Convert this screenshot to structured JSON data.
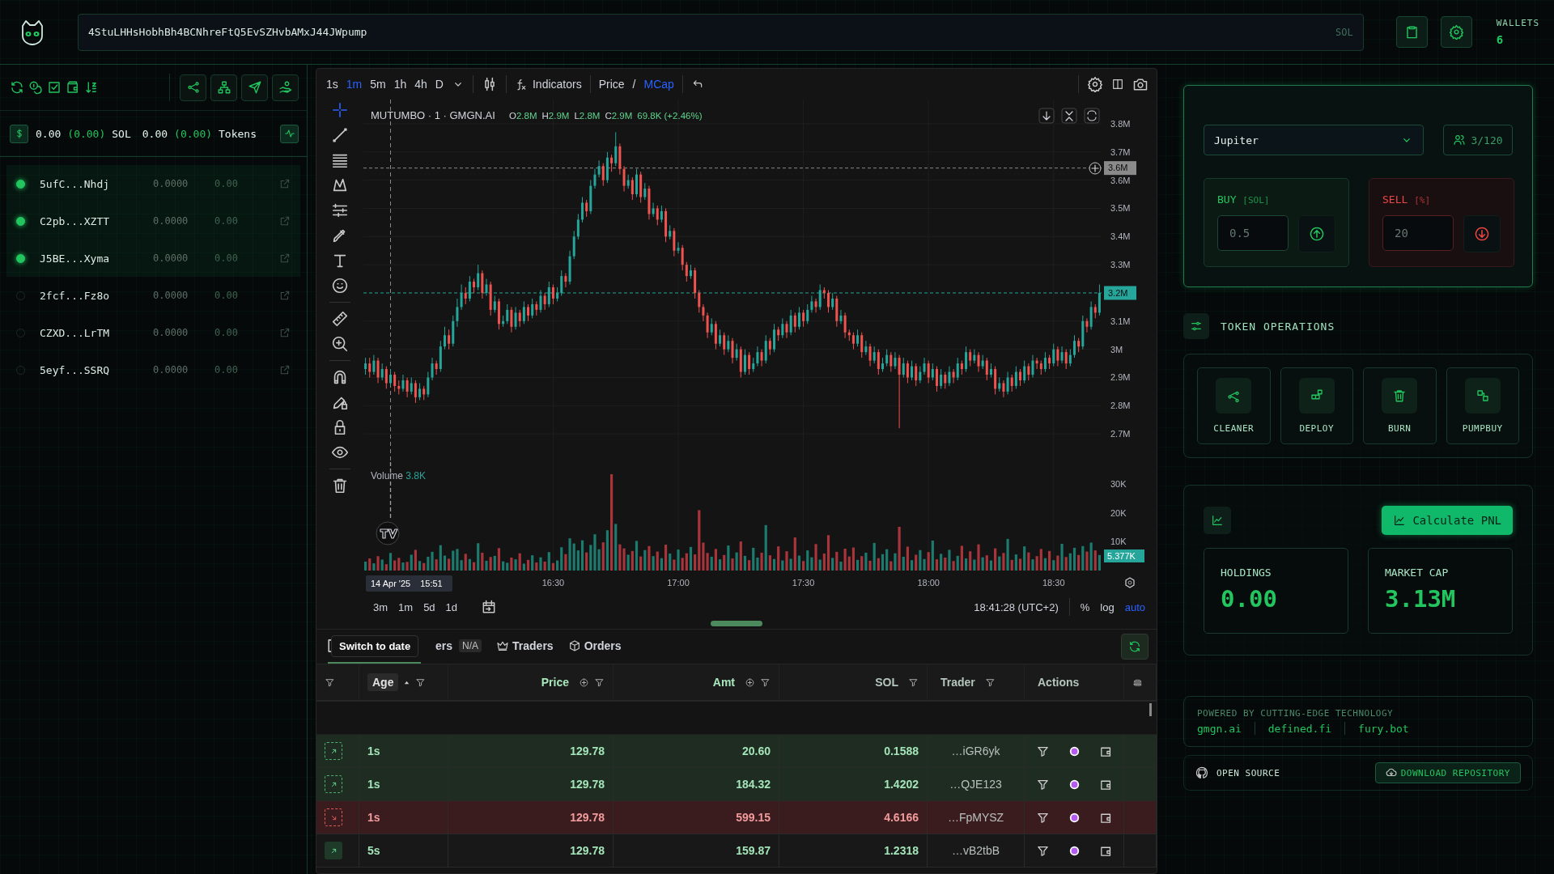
{
  "header": {
    "address": "4StuLHHsHobhBh4BCNhreFtQ5EvSZHvbAMxJ44JWpump",
    "address_suffix": "SOL",
    "wallets_label": "WALLETS",
    "wallets_count": "6"
  },
  "left_panel": {
    "balance": {
      "sol": "0.00",
      "sol_change": "(0.00)",
      "sol_unit": "SOL",
      "tokens": "0.00",
      "tokens_change": "(0.00)",
      "tokens_unit": "Tokens"
    },
    "wallets": [
      {
        "address": "5ufC...Nhdj",
        "selected": true,
        "balance": "0.0000",
        "value": "0.00"
      },
      {
        "address": "C2pb...XZTT",
        "selected": true,
        "balance": "0.0000",
        "value": "0.00"
      },
      {
        "address": "J5BE...Xyma",
        "selected": true,
        "balance": "0.0000",
        "value": "0.00"
      },
      {
        "address": "2fcf...Fz8o",
        "selected": false,
        "balance": "0.0000",
        "value": "0.00"
      },
      {
        "address": "CZXD...LrTM",
        "selected": false,
        "balance": "0.0000",
        "value": "0.00"
      },
      {
        "address": "5eyf...SSRQ",
        "selected": false,
        "balance": "0.0000",
        "value": "0.00"
      }
    ]
  },
  "chart": {
    "intervals": [
      {
        "label": "1s",
        "selected": false
      },
      {
        "label": "1m",
        "selected": true
      },
      {
        "label": "5m",
        "selected": false
      },
      {
        "label": "1h",
        "selected": false
      },
      {
        "label": "4h",
        "selected": false
      },
      {
        "label": "D",
        "selected": false
      }
    ],
    "indicators_label": "Indicators",
    "mode_separator": "/",
    "modes": [
      {
        "label": "Price",
        "selected": false
      },
      {
        "label": "MCap",
        "selected": true
      }
    ],
    "legend": {
      "title": "MUTUMBO · 1 · GMGN.AI",
      "ohlc": [
        {
          "key": "O",
          "value": "2.8M"
        },
        {
          "key": "H",
          "value": "2.9M"
        },
        {
          "key": "L",
          "value": "2.8M"
        },
        {
          "key": "C",
          "value": "2.9M"
        }
      ],
      "change": "69.8K (+2.46%)"
    },
    "price_pane": {
      "chart_data": {
        "type": "candlestick",
        "grid": true,
        "ylim": [
          2.6,
          3.886
        ],
        "ref_lines": [
          {
            "axis": "y",
            "value": 3.643,
            "label": "3.6M",
            "color": "#8a8a8a"
          },
          {
            "axis": "y",
            "value": 3.2,
            "label": "3.2M",
            "color": "#26a69a"
          }
        ],
        "yticks": [
          {
            "value": 3.8,
            "label": "3.8M"
          },
          {
            "value": 3.7,
            "label": "3.7M"
          },
          {
            "value": 3.6,
            "label": "3.6M"
          },
          {
            "value": 3.5,
            "label": "3.5M"
          },
          {
            "value": 3.4,
            "label": "3.4M"
          },
          {
            "value": 3.3,
            "label": "3.3M"
          },
          {
            "value": 3.1,
            "label": "3.1M"
          },
          {
            "value": 3.0,
            "label": "3M"
          },
          {
            "value": 2.9,
            "label": "2.9M"
          },
          {
            "value": 2.8,
            "label": "2.8M"
          },
          {
            "value": 2.7,
            "label": "2.7M"
          }
        ],
        "categories": [
          null,
          null,
          null,
          null,
          null,
          null,
          null,
          null,
          null,
          null,
          null,
          null,
          null,
          null,
          null,
          null,
          null,
          null,
          null,
          null,
          null,
          null,
          null,
          null,
          null,
          null,
          null,
          null,
          null,
          null,
          null,
          null,
          null,
          null,
          null,
          null,
          null,
          null,
          null,
          null,
          null,
          null,
          null,
          null,
          null,
          null,
          null,
          null,
          null,
          null,
          null,
          null,
          null,
          null,
          null,
          null,
          null,
          null,
          null,
          null,
          null,
          null,
          null,
          null,
          null,
          null,
          null,
          null,
          null,
          null,
          null,
          null,
          null,
          null,
          null,
          null,
          null,
          null,
          null,
          null,
          null,
          null,
          null,
          null,
          null,
          null,
          null,
          null,
          null,
          null,
          null,
          null,
          null,
          null,
          null,
          null,
          null,
          null,
          null,
          null,
          null,
          null,
          null,
          null,
          null,
          null,
          null,
          null,
          null,
          null,
          null,
          null,
          null,
          null,
          null,
          null,
          null,
          null,
          null,
          null,
          null,
          null,
          null,
          null,
          null,
          null,
          null,
          null,
          null,
          null,
          null,
          null,
          null,
          null,
          null,
          null,
          null,
          null,
          null,
          null,
          null,
          null,
          null,
          null,
          null,
          null,
          null,
          null,
          null,
          null,
          null,
          null,
          null,
          null,
          null,
          null,
          null,
          null,
          null,
          null,
          null,
          null,
          null,
          null,
          null,
          null,
          null,
          null,
          null,
          null,
          null,
          null,
          null,
          null,
          null,
          null,
          null
        ],
        "ohlc": [
          [
            2.93,
            2.97,
            2.91,
            2.95
          ],
          [
            2.95,
            2.97,
            2.9,
            2.92
          ],
          [
            2.92,
            2.98,
            2.91,
            2.96
          ],
          [
            2.96,
            2.97,
            2.88,
            2.9
          ],
          [
            2.9,
            2.95,
            2.89,
            2.93
          ],
          [
            2.93,
            2.94,
            2.86,
            2.88
          ],
          [
            2.88,
            2.93,
            2.87,
            2.91
          ],
          [
            2.91,
            2.92,
            2.85,
            2.87
          ],
          [
            2.87,
            2.89,
            2.84,
            2.86
          ],
          [
            2.86,
            2.91,
            2.85,
            2.89
          ],
          [
            2.89,
            2.9,
            2.83,
            2.85
          ],
          [
            2.85,
            2.9,
            2.84,
            2.88
          ],
          [
            2.88,
            2.89,
            2.81,
            2.83
          ],
          [
            2.83,
            2.88,
            2.82,
            2.86
          ],
          [
            2.86,
            2.87,
            2.82,
            2.84
          ],
          [
            2.84,
            2.92,
            2.83,
            2.9
          ],
          [
            2.9,
            2.97,
            2.89,
            2.95
          ],
          [
            2.95,
            2.96,
            2.91,
            2.93
          ],
          [
            2.93,
            3.03,
            2.92,
            3.01
          ],
          [
            3.01,
            3.08,
            3.0,
            3.05
          ],
          [
            3.05,
            3.07,
            3.0,
            3.02
          ],
          [
            3.02,
            3.12,
            3.01,
            3.1
          ],
          [
            3.1,
            3.18,
            3.08,
            3.15
          ],
          [
            3.15,
            3.23,
            3.14,
            3.2
          ],
          [
            3.2,
            3.22,
            3.16,
            3.18
          ],
          [
            3.18,
            3.26,
            3.17,
            3.24
          ],
          [
            3.24,
            3.25,
            3.2,
            3.22
          ],
          [
            3.22,
            3.3,
            3.21,
            3.27
          ],
          [
            3.27,
            3.28,
            3.18,
            3.2
          ],
          [
            3.2,
            3.25,
            3.19,
            3.23
          ],
          [
            3.23,
            3.24,
            3.12,
            3.14
          ],
          [
            3.14,
            3.19,
            3.13,
            3.17
          ],
          [
            3.17,
            3.18,
            3.07,
            3.09
          ],
          [
            3.09,
            3.12,
            3.08,
            3.1
          ],
          [
            3.1,
            3.16,
            3.09,
            3.14
          ],
          [
            3.14,
            3.15,
            3.06,
            3.08
          ],
          [
            3.08,
            3.15,
            3.07,
            3.13
          ],
          [
            3.13,
            3.14,
            3.08,
            3.1
          ],
          [
            3.1,
            3.17,
            3.09,
            3.15
          ],
          [
            3.15,
            3.16,
            3.1,
            3.12
          ],
          [
            3.12,
            3.18,
            3.11,
            3.16
          ],
          [
            3.16,
            3.17,
            3.12,
            3.14
          ],
          [
            3.14,
            3.21,
            3.13,
            3.19
          ],
          [
            3.19,
            3.2,
            3.14,
            3.16
          ],
          [
            3.16,
            3.24,
            3.15,
            3.22
          ],
          [
            3.22,
            3.23,
            3.16,
            3.18
          ],
          [
            3.18,
            3.22,
            3.17,
            3.2
          ],
          [
            3.2,
            3.28,
            3.19,
            3.26
          ],
          [
            3.26,
            3.27,
            3.22,
            3.24
          ],
          [
            3.24,
            3.35,
            3.23,
            3.33
          ],
          [
            3.33,
            3.42,
            3.32,
            3.4
          ],
          [
            3.4,
            3.48,
            3.39,
            3.46
          ],
          [
            3.46,
            3.54,
            3.45,
            3.52
          ],
          [
            3.52,
            3.53,
            3.47,
            3.49
          ],
          [
            3.49,
            3.6,
            3.48,
            3.58
          ],
          [
            3.58,
            3.64,
            3.57,
            3.62
          ],
          [
            3.62,
            3.67,
            3.61,
            3.65
          ],
          [
            3.65,
            3.66,
            3.58,
            3.6
          ],
          [
            3.6,
            3.7,
            3.59,
            3.68
          ],
          [
            3.68,
            3.69,
            3.63,
            3.66
          ],
          [
            3.66,
            3.77,
            3.65,
            3.72
          ],
          [
            3.72,
            3.73,
            3.62,
            3.64
          ],
          [
            3.64,
            3.65,
            3.56,
            3.58
          ],
          [
            3.58,
            3.62,
            3.57,
            3.6
          ],
          [
            3.6,
            3.61,
            3.53,
            3.55
          ],
          [
            3.55,
            3.64,
            3.54,
            3.62
          ],
          [
            3.62,
            3.63,
            3.52,
            3.54
          ],
          [
            3.54,
            3.59,
            3.53,
            3.57
          ],
          [
            3.57,
            3.58,
            3.46,
            3.48
          ],
          [
            3.48,
            3.52,
            3.47,
            3.5
          ],
          [
            3.5,
            3.51,
            3.44,
            3.46
          ],
          [
            3.46,
            3.51,
            3.45,
            3.49
          ],
          [
            3.49,
            3.5,
            3.38,
            3.4
          ],
          [
            3.4,
            3.44,
            3.39,
            3.42
          ],
          [
            3.42,
            3.43,
            3.33,
            3.35
          ],
          [
            3.35,
            3.38,
            3.34,
            3.36
          ],
          [
            3.36,
            3.37,
            3.28,
            3.3
          ],
          [
            3.3,
            3.31,
            3.24,
            3.26
          ],
          [
            3.26,
            3.3,
            3.25,
            3.28
          ],
          [
            3.28,
            3.29,
            3.18,
            3.2
          ],
          [
            3.2,
            3.21,
            3.13,
            3.15
          ],
          [
            3.15,
            3.16,
            3.1,
            3.12
          ],
          [
            3.12,
            3.13,
            3.04,
            3.06
          ],
          [
            3.06,
            3.11,
            3.05,
            3.09
          ],
          [
            3.09,
            3.1,
            3.0,
            3.02
          ],
          [
            3.02,
            3.07,
            3.01,
            3.05
          ],
          [
            3.05,
            3.06,
            2.98,
            3.0
          ],
          [
            3.0,
            3.05,
            2.99,
            3.03
          ],
          [
            3.03,
            3.04,
            2.95,
            2.97
          ],
          [
            2.97,
            3.02,
            2.96,
            3.0
          ],
          [
            3.0,
            3.01,
            2.9,
            2.92
          ],
          [
            2.92,
            3.0,
            2.91,
            2.98
          ],
          [
            2.98,
            2.99,
            2.91,
            2.93
          ],
          [
            2.93,
            2.97,
            2.92,
            2.95
          ],
          [
            2.95,
            3.01,
            2.94,
            2.99
          ],
          [
            2.99,
            3.0,
            2.94,
            2.96
          ],
          [
            2.96,
            3.05,
            2.95,
            3.03
          ],
          [
            3.03,
            3.04,
            2.98,
            3.0
          ],
          [
            3.0,
            3.09,
            2.99,
            3.07
          ],
          [
            3.07,
            3.08,
            3.03,
            3.05
          ],
          [
            3.05,
            3.11,
            3.04,
            3.09
          ],
          [
            3.09,
            3.1,
            3.04,
            3.06
          ],
          [
            3.06,
            3.14,
            3.05,
            3.12
          ],
          [
            3.12,
            3.13,
            3.06,
            3.08
          ],
          [
            3.08,
            3.15,
            3.07,
            3.13
          ],
          [
            3.13,
            3.14,
            3.08,
            3.1
          ],
          [
            3.1,
            3.16,
            3.09,
            3.14
          ],
          [
            3.14,
            3.19,
            3.13,
            3.17
          ],
          [
            3.17,
            3.18,
            3.13,
            3.15
          ],
          [
            3.15,
            3.23,
            3.14,
            3.21
          ],
          [
            3.21,
            3.22,
            3.18,
            3.2
          ],
          [
            3.2,
            3.21,
            3.13,
            3.15
          ],
          [
            3.15,
            3.2,
            3.14,
            3.18
          ],
          [
            3.18,
            3.19,
            3.08,
            3.1
          ],
          [
            3.1,
            3.14,
            3.09,
            3.12
          ],
          [
            3.12,
            3.13,
            3.04,
            3.06
          ],
          [
            3.06,
            3.07,
            3.03,
            3.05
          ],
          [
            3.05,
            3.06,
            3.0,
            3.02
          ],
          [
            3.02,
            3.07,
            3.01,
            3.05
          ],
          [
            3.05,
            3.06,
            2.97,
            2.99
          ],
          [
            2.99,
            3.03,
            2.98,
            3.01
          ],
          [
            3.01,
            3.02,
            2.94,
            2.96
          ],
          [
            2.96,
            3.01,
            2.95,
            2.99
          ],
          [
            2.99,
            3.0,
            2.91,
            2.93
          ],
          [
            2.93,
            2.97,
            2.92,
            2.95
          ],
          [
            2.95,
            3.0,
            2.94,
            2.98
          ],
          [
            2.98,
            2.99,
            2.92,
            2.94
          ],
          [
            2.94,
            2.99,
            2.93,
            2.97
          ],
          [
            2.97,
            2.98,
            2.72,
            2.91
          ],
          [
            2.91,
            2.97,
            2.9,
            2.95
          ],
          [
            2.95,
            2.96,
            2.88,
            2.9
          ],
          [
            2.9,
            2.96,
            2.89,
            2.94
          ],
          [
            2.94,
            2.95,
            2.87,
            2.89
          ],
          [
            2.89,
            2.94,
            2.88,
            2.92
          ],
          [
            2.92,
            2.97,
            2.91,
            2.95
          ],
          [
            2.95,
            2.96,
            2.88,
            2.9
          ],
          [
            2.9,
            2.95,
            2.89,
            2.93
          ],
          [
            2.93,
            2.94,
            2.85,
            2.87
          ],
          [
            2.87,
            2.93,
            2.86,
            2.91
          ],
          [
            2.91,
            2.92,
            2.86,
            2.88
          ],
          [
            2.88,
            2.94,
            2.87,
            2.92
          ],
          [
            2.92,
            2.93,
            2.88,
            2.9
          ],
          [
            2.9,
            2.97,
            2.89,
            2.95
          ],
          [
            2.95,
            2.96,
            2.91,
            2.93
          ],
          [
            2.93,
            3.01,
            2.92,
            2.99
          ],
          [
            2.99,
            3.0,
            2.94,
            2.96
          ],
          [
            2.96,
            3.0,
            2.95,
            2.98
          ],
          [
            2.98,
            2.99,
            2.92,
            2.94
          ],
          [
            2.94,
            2.98,
            2.93,
            2.96
          ],
          [
            2.96,
            2.97,
            2.89,
            2.91
          ],
          [
            2.91,
            2.95,
            2.9,
            2.93
          ],
          [
            2.93,
            2.94,
            2.84,
            2.86
          ],
          [
            2.86,
            2.9,
            2.85,
            2.88
          ],
          [
            2.88,
            2.89,
            2.83,
            2.85
          ],
          [
            2.85,
            2.92,
            2.84,
            2.9
          ],
          [
            2.9,
            2.91,
            2.85,
            2.87
          ],
          [
            2.87,
            2.94,
            2.86,
            2.92
          ],
          [
            2.92,
            2.93,
            2.87,
            2.89
          ],
          [
            2.89,
            2.96,
            2.88,
            2.94
          ],
          [
            2.94,
            2.95,
            2.89,
            2.91
          ],
          [
            2.91,
            2.98,
            2.9,
            2.96
          ],
          [
            2.96,
            2.97,
            2.93,
            2.95
          ],
          [
            2.95,
            2.96,
            2.91,
            2.93
          ],
          [
            2.93,
            2.99,
            2.92,
            2.97
          ],
          [
            2.97,
            2.98,
            2.93,
            2.95
          ],
          [
            2.95,
            3.02,
            2.94,
            3.0
          ],
          [
            3.0,
            3.01,
            2.94,
            2.96
          ],
          [
            2.96,
            3.01,
            2.95,
            2.99
          ],
          [
            2.99,
            3.0,
            2.93,
            2.95
          ],
          [
            2.95,
            3.0,
            2.94,
            2.98
          ],
          [
            2.98,
            3.05,
            2.97,
            3.03
          ],
          [
            3.03,
            3.04,
            2.99,
            3.01
          ],
          [
            3.01,
            3.12,
            3.0,
            3.1
          ],
          [
            3.1,
            3.11,
            3.06,
            3.08
          ],
          [
            3.08,
            3.17,
            3.07,
            3.15
          ],
          [
            3.15,
            3.16,
            3.11,
            3.13
          ],
          [
            3.13,
            3.23,
            3.12,
            3.2
          ]
        ]
      }
    },
    "volume_pane": {
      "label": "Volume",
      "value": "3.8K",
      "chart_data": {
        "type": "bar",
        "grid": true,
        "ylim": [
          0,
          37.7
        ],
        "categories": [
          null,
          null,
          null,
          null,
          null,
          null,
          null,
          null,
          null,
          null,
          null,
          null,
          null,
          null,
          null,
          null,
          null,
          null,
          null,
          null,
          null,
          null,
          null,
          null,
          null,
          null,
          null,
          null,
          null,
          null,
          null,
          null,
          null,
          null,
          null,
          null,
          null,
          null,
          null,
          null,
          null,
          null,
          null,
          null,
          null,
          null,
          null,
          null,
          null,
          null,
          null,
          null,
          null,
          null,
          null,
          null,
          null,
          null,
          null,
          null,
          null,
          null,
          null,
          null,
          null,
          null,
          null,
          null,
          null,
          null,
          null,
          null,
          null,
          null,
          null,
          null,
          null,
          null,
          null,
          null,
          null,
          null,
          null,
          null,
          null,
          null,
          null,
          null,
          null,
          null,
          null,
          null,
          null,
          null,
          null,
          null,
          null,
          null,
          null,
          null,
          null,
          null,
          null,
          null,
          null,
          null,
          null,
          null,
          null,
          null,
          null,
          null,
          null,
          null,
          null,
          null,
          null,
          null,
          null,
          null,
          null,
          null,
          null,
          null,
          null,
          null,
          null,
          null,
          null,
          null,
          null,
          null,
          null,
          null,
          null,
          null,
          null,
          null,
          null,
          null,
          null,
          null,
          null,
          null,
          null,
          null,
          null,
          null,
          null,
          null,
          null,
          null,
          null,
          null,
          null,
          null,
          null,
          null,
          null,
          null,
          null,
          null,
          null,
          null,
          null,
          null,
          null,
          null,
          null,
          null,
          null,
          null,
          null,
          null,
          null,
          null,
          null
        ],
        "yticks": [
          {
            "value": 30,
            "label": "30K"
          },
          {
            "value": 20,
            "label": "20K"
          },
          {
            "value": 10,
            "label": "10K"
          }
        ],
        "values": [
          3.1,
          4.2,
          2.5,
          5.0,
          3.8,
          2.2,
          6.1,
          3.5,
          4.4,
          2.8,
          3.0,
          5.5,
          7.2,
          3.3,
          2.6,
          4.8,
          6.5,
          3.9,
          8.8,
          5.2,
          4.1,
          6.9,
          7.5,
          3.6,
          5.8,
          4.0,
          2.9,
          9.5,
          6.2,
          3.4,
          4.7,
          5.1,
          7.8,
          3.2,
          2.7,
          4.5,
          3.9,
          6.0,
          2.4,
          3.7,
          5.3,
          2.8,
          4.6,
          3.1,
          6.4,
          2.6,
          3.5,
          8.1,
          5.7,
          11.2,
          9.4,
          7.0,
          10.5,
          6.3,
          8.9,
          12.6,
          7.4,
          9.8,
          14.0,
          33.5,
          16.2,
          9.1,
          7.7,
          5.5,
          6.8,
          10.3,
          4.9,
          7.1,
          8.5,
          5.0,
          6.6,
          4.3,
          9.0,
          5.9,
          3.8,
          7.3,
          4.4,
          6.0,
          8.2,
          5.6,
          21.0,
          9.7,
          6.1,
          4.8,
          7.5,
          3.9,
          5.4,
          8.7,
          4.2,
          6.3,
          10.1,
          5.1,
          3.6,
          7.9,
          4.5,
          6.2,
          15.8,
          5.3,
          4.0,
          8.4,
          3.5,
          6.7,
          4.1,
          11.5,
          5.2,
          3.3,
          7.0,
          4.6,
          9.2,
          3.8,
          5.9,
          12.3,
          4.4,
          6.5,
          3.1,
          7.6,
          4.9,
          8.0,
          3.7,
          5.0,
          6.2,
          3.4,
          9.6,
          4.3,
          5.7,
          7.4,
          3.2,
          6.0,
          15.2,
          4.8,
          8.3,
          3.6,
          5.5,
          7.1,
          4.0,
          6.4,
          10.4,
          3.9,
          5.8,
          4.5,
          7.2,
          3.3,
          5.1,
          8.6,
          4.2,
          6.7,
          3.8,
          9.1,
          4.6,
          5.3,
          3.5,
          7.7,
          4.9,
          6.1,
          11.0,
          3.7,
          5.6,
          4.1,
          8.4,
          6.3,
          3.9,
          5.0,
          7.5,
          4.3,
          6.8,
          3.6,
          5.2,
          9.3,
          4.7,
          6.0,
          7.9,
          5.4,
          8.5,
          6.6,
          9.7,
          7.0,
          5.4
        ]
      }
    },
    "time_labels": [
      "16:30",
      "17:00",
      "17:30",
      "18:00",
      "18:30"
    ],
    "last_volume": "5.377K",
    "crosshair_date": "14 Apr '25",
    "crosshair_time": "15:51",
    "ranges": [
      "3m",
      "1m",
      "5d",
      "1d"
    ],
    "clock": "18:41:28 (UTC+2)",
    "scale_options": [
      {
        "label": "%",
        "selected": false
      },
      {
        "label": "log",
        "selected": false
      },
      {
        "label": "auto",
        "selected": true
      }
    ]
  },
  "trades": {
    "tabs": [
      {
        "selected": true
      },
      {
        "label": "ers",
        "badge": "N/A",
        "selected": false
      },
      {
        "label": "Traders",
        "selected": false
      },
      {
        "label": "Orders",
        "selected": false
      }
    ],
    "tooltip": "Switch to date",
    "columns": [
      {
        "label": "Age",
        "sorted": true
      },
      {
        "label": "Price",
        "sorted": false
      },
      {
        "label": "Amt",
        "sorted": false
      },
      {
        "label": "SOL",
        "sorted": false
      },
      {
        "label": "Trader",
        "sorted": false
      },
      {
        "label": "Actions",
        "sorted": false
      }
    ],
    "rows": [
      {
        "kind": "buy",
        "fresh": true,
        "age": "1s",
        "price": "129.78",
        "amount": "20.60",
        "sol": "0.1588",
        "trader": "…iGR6yk"
      },
      {
        "kind": "buy",
        "fresh": true,
        "age": "1s",
        "price": "129.78",
        "amount": "184.32",
        "sol": "1.4202",
        "trader": "…QJE123"
      },
      {
        "kind": "sell",
        "fresh": true,
        "age": "1s",
        "price": "129.78",
        "amount": "599.15",
        "sol": "4.6166",
        "trader": "…FpMYSZ"
      },
      {
        "kind": "buy",
        "fresh": false,
        "age": "5s",
        "price": "129.78",
        "amount": "159.87",
        "sol": "1.2318",
        "trader": "…vB2tbB"
      }
    ]
  },
  "right_panel": {
    "swap": {
      "router": "Jupiter",
      "wallet_count": "3/120",
      "buy": {
        "label": "BUY",
        "unit": "[SOL]",
        "placeholder": "0.5"
      },
      "sell": {
        "label": "SELL",
        "unit": "[%]",
        "placeholder": "20"
      }
    },
    "operations": {
      "title": "TOKEN OPERATIONS",
      "items": [
        "CLEANER",
        "DEPLOY",
        "BURN",
        "PUMPBUY"
      ]
    },
    "pnl": {
      "button": "Calculate PNL",
      "stats": [
        {
          "label": "HOLDINGS",
          "value": "0.00"
        },
        {
          "label": "MARKET CAP",
          "value": "3.13M"
        }
      ]
    },
    "footer": {
      "powered_label": "POWERED BY CUTTING-EDGE TECHNOLOGY",
      "links": [
        "gmgn.ai",
        "defined.fi",
        "fury.bot"
      ],
      "open_source": "OPEN SOURCE",
      "download": "DOWNLOAD REPOSITORY"
    }
  }
}
